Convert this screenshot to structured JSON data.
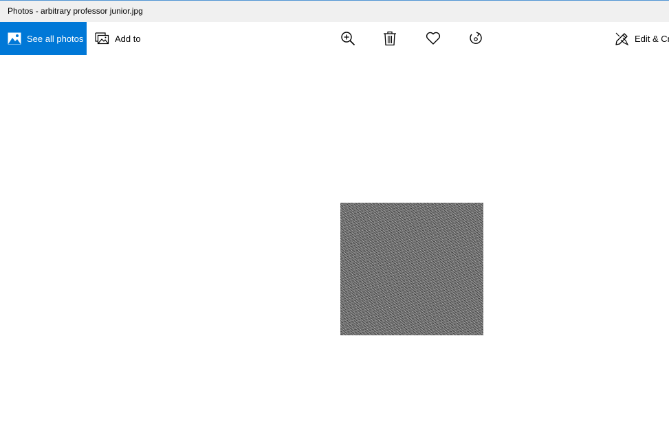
{
  "window": {
    "title": "Photos - arbitrary professor junior.jpg"
  },
  "toolbar": {
    "see_all_photos_label": "See all photos",
    "add_to_label": "Add to",
    "edit_create_label": "Edit & Cre",
    "icons": {
      "see_all_photos": "photo-gallery-icon",
      "add_to": "add-to-album-icon",
      "zoom": "zoom-in-icon",
      "delete": "trash-icon",
      "favorite": "heart-icon",
      "rotate": "rotate-icon",
      "edit": "edit-pen-icon"
    }
  },
  "colors": {
    "accent": "#0078d7",
    "titlebar_bg": "#f0f0f0",
    "canvas_bg": "#ffffff"
  }
}
